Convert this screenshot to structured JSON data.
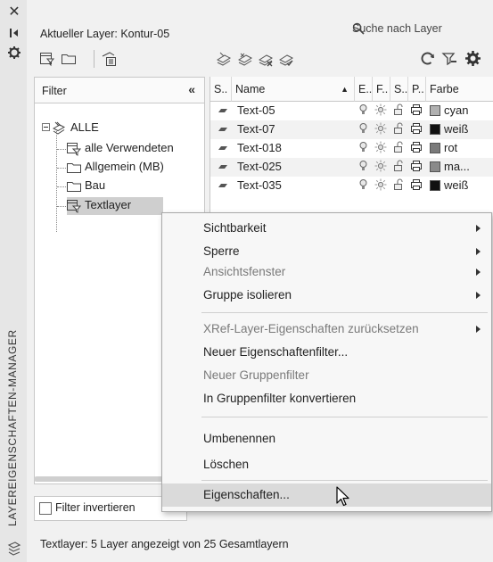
{
  "header": {
    "current_layer": "Aktueller Layer: Kontur-05",
    "search_placeholder": "Suche nach Layer"
  },
  "side_title": "LAYEREIGENSCHAFTEN-MANAGER",
  "filter": {
    "header": "Filter",
    "collapse_glyph": "«",
    "tree": [
      {
        "label": "ALLE",
        "icon": "all-filter-icon"
      },
      {
        "label": "alle Verwendeten",
        "icon": "property-filter-icon"
      },
      {
        "label": "Allgemein (MB)",
        "icon": "group-filter-icon"
      },
      {
        "label": "Bau",
        "icon": "group-filter-icon"
      },
      {
        "label": "Textlayer",
        "icon": "property-filter-icon",
        "selected": true
      }
    ],
    "invert_label": "Filter invertieren"
  },
  "grid": {
    "columns": [
      "S..",
      "Name",
      "E..",
      "F..",
      "S..",
      "P..",
      "Farbe"
    ],
    "rows": [
      {
        "name": "Text-05",
        "color_name": "cyan",
        "swatch": "#b0b0b0"
      },
      {
        "name": "Text-07",
        "color_name": "weiß",
        "swatch": "#111111"
      },
      {
        "name": "Text-018",
        "color_name": "rot",
        "swatch": "#7a7a7a"
      },
      {
        "name": "Text-025",
        "color_name": "ma...",
        "swatch": "#8a8a8a"
      },
      {
        "name": "Text-035",
        "color_name": "weiß",
        "swatch": "#111111"
      }
    ]
  },
  "context_menu": {
    "items": [
      {
        "label": "Sichtbarkeit",
        "submenu": true,
        "disabled": false
      },
      {
        "label": "Sperre",
        "submenu": true,
        "disabled": false
      },
      {
        "label": "Ansichtsfenster",
        "submenu": true,
        "disabled": true
      },
      {
        "label": "Gruppe isolieren",
        "submenu": true,
        "disabled": false
      },
      {
        "label": "XRef-Layer-Eigenschaften zurücksetzen",
        "submenu": true,
        "disabled": true
      },
      {
        "label": "Neuer Eigenschaftenfilter...",
        "submenu": false,
        "disabled": false
      },
      {
        "label": "Neuer Gruppenfilter",
        "submenu": false,
        "disabled": true
      },
      {
        "label": "In Gruppenfilter konvertieren",
        "submenu": false,
        "disabled": false
      },
      {
        "label": "Umbenennen",
        "submenu": false,
        "disabled": false
      },
      {
        "label": "Löschen",
        "submenu": false,
        "disabled": false
      },
      {
        "label": "Eigenschaften...",
        "submenu": false,
        "disabled": false,
        "highlighted": true
      }
    ]
  },
  "status": "Textlayer: 5 Layer angezeigt von 25 Gesamtlayern"
}
